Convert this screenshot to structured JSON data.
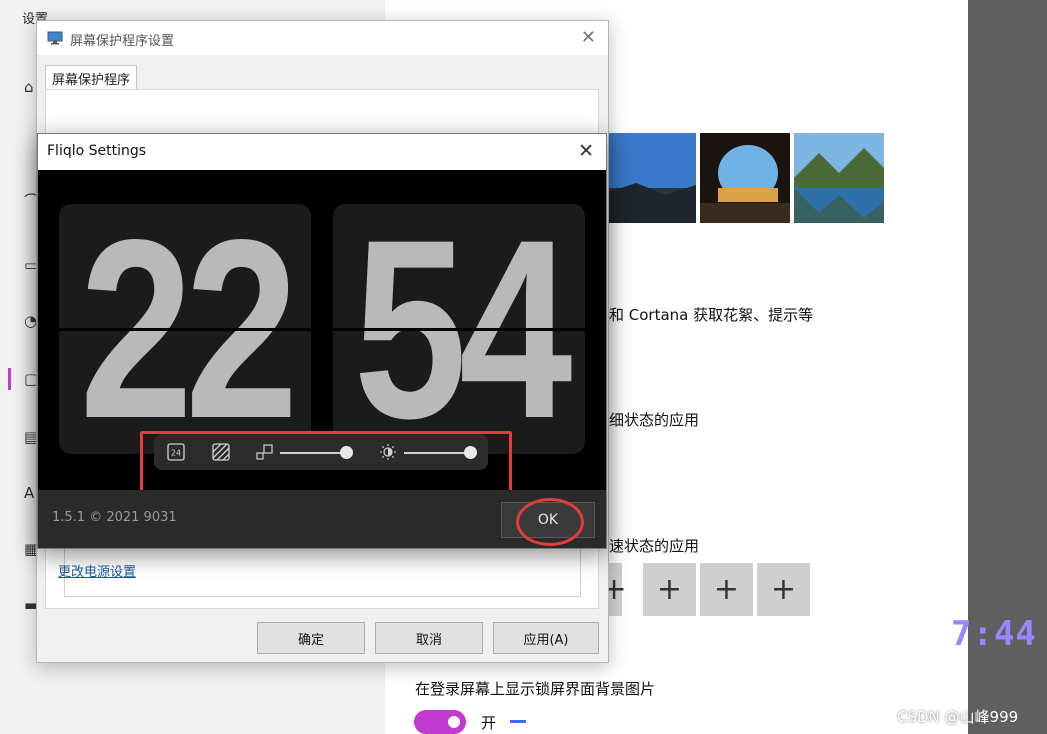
{
  "settings": {
    "title": "设置",
    "text_cortana": "和 Cortana 获取花絮、提示等",
    "text_detail_apps": "细状态的应用",
    "text_quick_apps": "速状态的应用",
    "text_lock_bg": "在登录屏幕上显示锁屏界面背景图片",
    "toggle_state": "开",
    "plus": "+"
  },
  "overlay": {
    "clock": "7:44",
    "watermark": "CSDN @山峰999"
  },
  "screensaver_dialog": {
    "title": "屏幕保护程序设置",
    "close": "✕",
    "tab": "屏幕保护程序",
    "power_link": "更改电源设置",
    "ok_button": "确定",
    "cancel_button": "取消",
    "apply_button": "应用(A)"
  },
  "fliqlo": {
    "title": "Fliqlo Settings",
    "close": "✕",
    "hours": "22",
    "minutes": "54",
    "format_label": "24",
    "version": "1.5.1 © 2021 9031",
    "ok_button": "OK",
    "size_level": 1.0,
    "brightness_level": 1.0
  },
  "colors": {
    "accent_purple": "#c139cf",
    "highlight_red": "#e23c3c",
    "clock_purple": "#9b85ff"
  }
}
